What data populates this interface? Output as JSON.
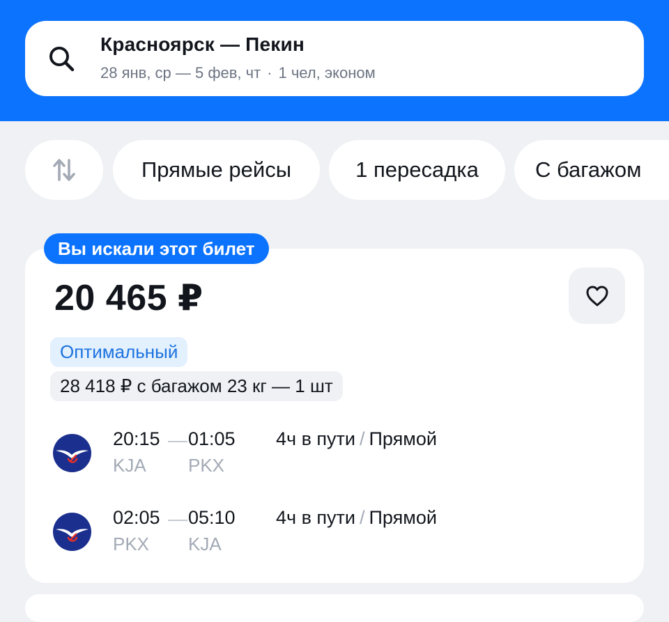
{
  "search": {
    "route": "Красноярск — Пекин",
    "dates": "28 янв, ср — 5 фев, чт",
    "separator": "·",
    "passengers": "1 чел, эконом"
  },
  "filters": {
    "sort_icon": "sort-arrows-icon",
    "items": [
      "Прямые рейсы",
      "1 пересадка",
      "С багажом"
    ]
  },
  "ticket": {
    "badge": "Вы искали этот билет",
    "price": "20 465 ₽",
    "tag_optimal": "Оптимальный",
    "baggage_offer": "28 418 ₽ с багажом 23 кг — 1 шт",
    "favorite_icon": "heart-icon",
    "segments": [
      {
        "airline_icon": "aeroflot-logo-icon",
        "dep_time": "20:15",
        "arr_time": "01:05",
        "dep_code": "KJA",
        "arr_code": "PKX",
        "duration": "4ч в пути",
        "slash": "/",
        "type": "Прямой"
      },
      {
        "airline_icon": "aeroflot-logo-icon",
        "dep_time": "02:05",
        "arr_time": "05:10",
        "dep_code": "PKX",
        "arr_code": "KJA",
        "duration": "4ч в пути",
        "slash": "/",
        "type": "Прямой"
      }
    ]
  },
  "colors": {
    "brand": "#0c73fe",
    "background": "#eff1f4",
    "optimal_text": "#1b72e0",
    "optimal_bg": "#e3f0fd",
    "airline_logo": "#1a2f8e"
  }
}
